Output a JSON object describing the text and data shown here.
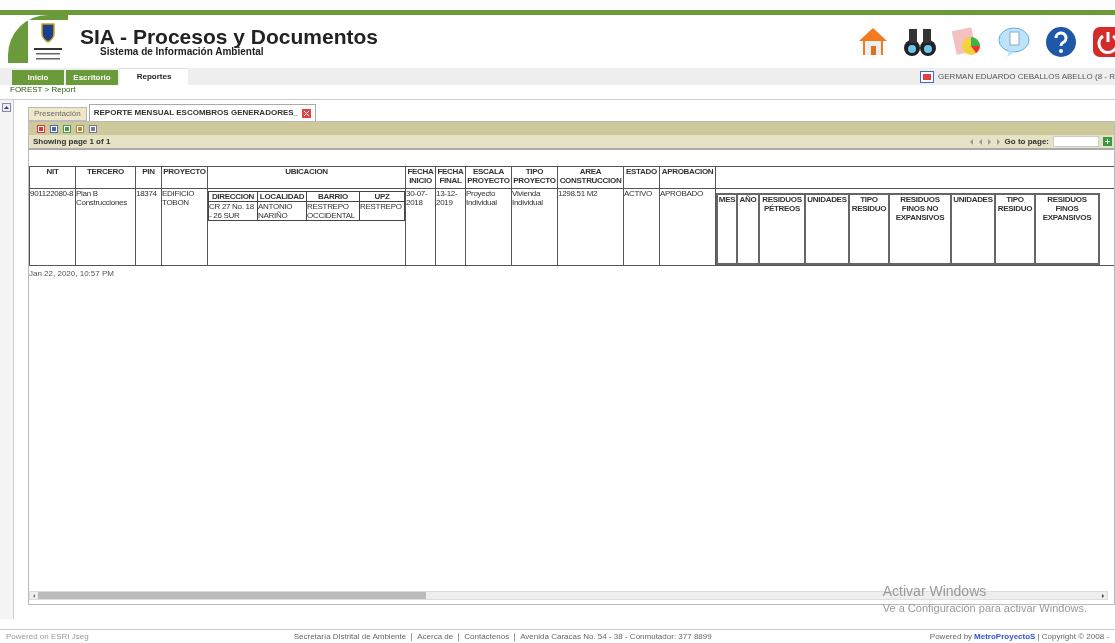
{
  "header": {
    "title": "SIA - Procesos y Documentos",
    "subtitle": "Sistema de Información Ambiental"
  },
  "nav_tabs": [
    {
      "label": "Inicio",
      "selected": false
    },
    {
      "label": "Escritorio",
      "selected": false
    },
    {
      "label": "Reportes",
      "selected": true
    }
  ],
  "user": "GERMAN EDUARDO CEBALLOS ABELLO (8 - R",
  "breadcrumb": "FOREST > Report",
  "doc_tabs": [
    {
      "label": "Presentación",
      "selected": false,
      "closable": false
    },
    {
      "label": "REPORTE MENSUAL ESCOMBROS GENERADORES_",
      "selected": true,
      "closable": true
    }
  ],
  "pager": {
    "status": "Showing page 1 of 1",
    "goto_label": "Go to page:"
  },
  "table": {
    "columns": [
      "NIT",
      "TERCERO",
      "PIN",
      "PROYECTO",
      "UBICACION",
      "FECHA INICIO",
      "FECHA FINAL",
      "ESCALA PROYECTO",
      "TIPO PROYECTO",
      "AREA CONSTRUCCION",
      "ESTADO",
      "APROBACION"
    ],
    "location_columns": [
      "DIRECCION",
      "LOCALIDAD",
      "BARRIO",
      "UPZ"
    ],
    "rows": [
      {
        "cells": [
          "901122080-8",
          "Plan B Construcciones",
          "18374",
          "EDIFICIO TOBON",
          "",
          "30-07-2018",
          "13-12-2019",
          "Proyecto Individual",
          "Vivienda Individual",
          "1298.51 M2",
          "ACTIVO",
          "APROBADO"
        ],
        "location": [
          "CR 27 No. 18 - 26 SUR",
          "ANTONIO NARIÑO",
          "RESTREPO OCCIDENTAL",
          "RESTREPO"
        ]
      }
    ],
    "waste_columns": [
      "MES",
      "AÑO",
      "RESIDUOS PÉTREOS",
      "UNIDADES",
      "TIPO RESIDUO",
      "RESIDUOS FINOS NO EXPANSIVOS",
      "UNIDADES",
      "TIPO RESIDUO",
      "RESIDUOS FINOS EXPANSIVOS"
    ]
  },
  "generated": "Jan 22, 2020, 10:57 PM",
  "os_notice": {
    "title": "Activar Windows",
    "text": "Ve a Configuración para activar Windows."
  },
  "footer": {
    "left": "Powered on ESRI Jseg",
    "links": [
      "Secretaría Distrital de Ambiente",
      "Acerca de",
      "Contáctenos",
      "Avenida Caracas No. 54 - 38 - Conmutador: 377 8899"
    ],
    "powered": "Powered by",
    "brand": "MetroProyectoS",
    "copyright": "| Copyright © 2008 -"
  }
}
